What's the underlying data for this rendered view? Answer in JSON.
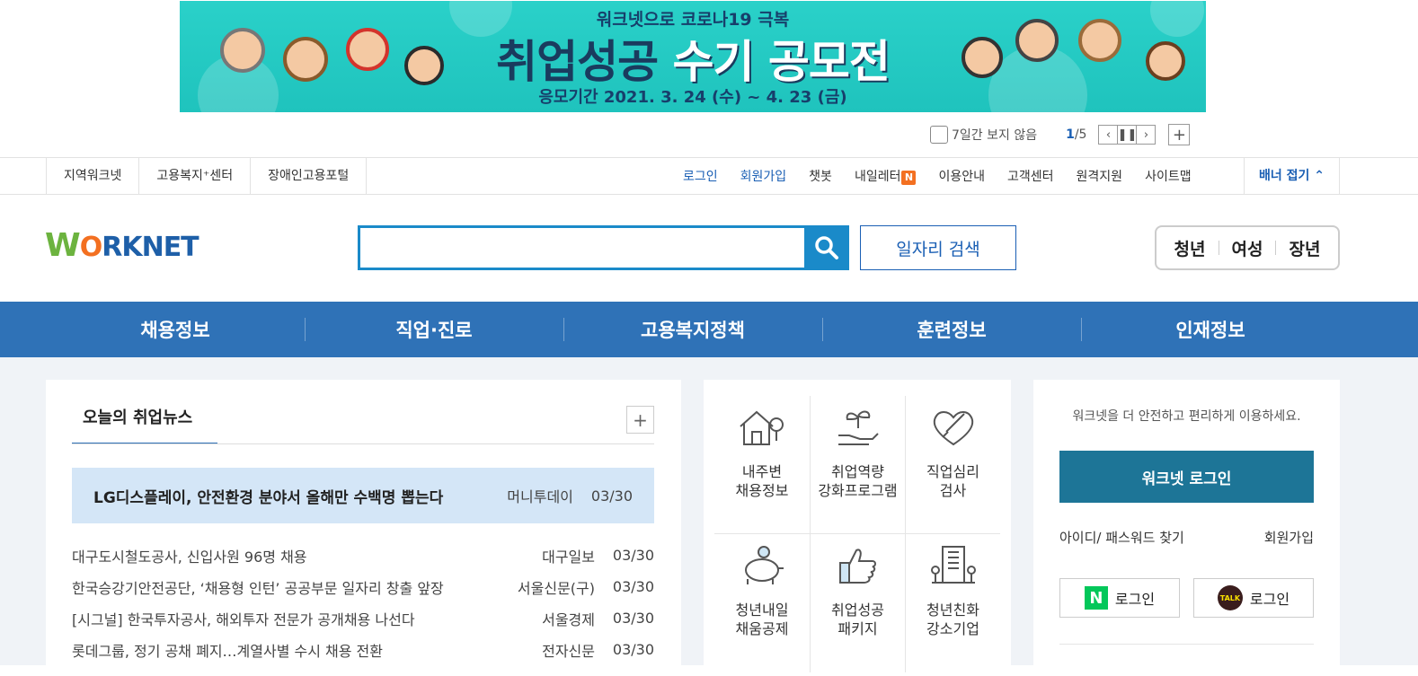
{
  "banner": {
    "subtitle": "워크넷으로 코로나19 극복",
    "title_part1": "취업성공",
    "title_part2": "수기 공모전",
    "period": "응모기간 2021. 3. 24 (수) ~ 4. 23 (금)",
    "hide_label": "7일간 보지 않음",
    "page_current": "1",
    "page_total": "/5"
  },
  "util": {
    "left_links": [
      "지역워크넷",
      "고용복지⁺센터",
      "장애인고용포털"
    ],
    "login": "로그인",
    "join": "회원가입",
    "chatbot": "챗봇",
    "letter": "내일레터",
    "letter_badge": "N",
    "guide": "이용안내",
    "customer": "고객센터",
    "remote": "원격지원",
    "sitemap": "사이트맵",
    "fold_banner": "배너 접기"
  },
  "header": {
    "logo_w": "W",
    "logo_o": "O",
    "logo_rest": "RKNET",
    "search_placeholder": "",
    "job_search": "일자리 검색",
    "target_youth": "청년",
    "target_women": "여성",
    "target_senior": "장년"
  },
  "gnb": [
    "채용정보",
    "직업·진로",
    "고용복지정책",
    "훈련정보",
    "인재정보"
  ],
  "news": {
    "tab": "오늘의 취업뉴스",
    "highlight": {
      "title": "LG디스플레이, 안전환경 분야서 올해만 수백명 뽑는다",
      "source": "머니투데이",
      "date": "03/30"
    },
    "items": [
      {
        "title": "대구도시철도공사, 신입사원 96명 채용",
        "source": "대구일보",
        "date": "03/30"
      },
      {
        "title": "한국승강기안전공단, ‘채용형 인턴’ 공공부문 일자리 창출 앞장",
        "source": "서울신문(구)",
        "date": "03/30"
      },
      {
        "title": "[시그널] 한국투자공사, 해외투자 전문가 공개채용 나선다",
        "source": "서울경제",
        "date": "03/30"
      },
      {
        "title": "롯데그룹, 정기 공채 폐지…계열사별 수시 채용 전환",
        "source": "전자신문",
        "date": "03/30"
      }
    ]
  },
  "services": [
    {
      "line1": "내주변",
      "line2": "채용정보",
      "icon": "house-location-icon"
    },
    {
      "line1": "취업역량",
      "line2": "강화프로그램",
      "icon": "sprout-hand-icon"
    },
    {
      "line1": "직업심리",
      "line2": "검사",
      "icon": "heart-check-icon"
    },
    {
      "line1": "청년내일",
      "line2": "채움공제",
      "icon": "piggy-bank-icon"
    },
    {
      "line1": "취업성공",
      "line2": "패키지",
      "icon": "thumbs-up-icon"
    },
    {
      "line1": "청년친화",
      "line2": "강소기업",
      "icon": "building-icon"
    }
  ],
  "login": {
    "message": "워크넷을 더 안전하고 편리하게 이용하세요.",
    "button": "워크넷 로그인",
    "find": "아이디/ 패스워드 찾기",
    "join": "회원가입",
    "naver": "로그인",
    "kakao": "로그인",
    "naver_mark": "N",
    "kakao_mark": "TALK"
  },
  "colors": {
    "primary": "#2f72b7",
    "search": "#1a8ac9",
    "login": "#1d7597",
    "banner": "#2ad1c9",
    "badge": "#f37021"
  }
}
